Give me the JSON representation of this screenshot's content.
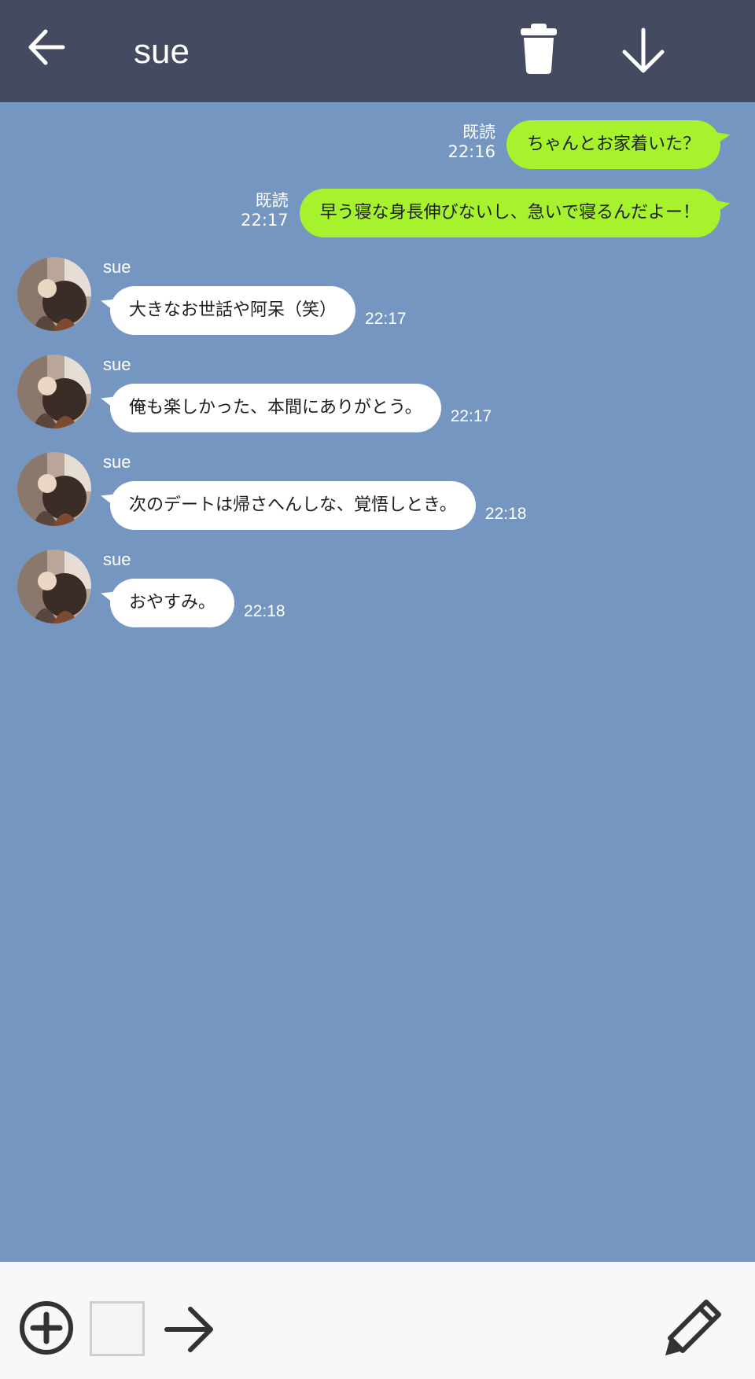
{
  "header": {
    "title": "sue",
    "back_icon": "arrow-left-icon",
    "trash_icon": "trash-icon",
    "download_icon": "arrow-down-icon"
  },
  "messages": [
    {
      "direction": "sent",
      "read": "既読",
      "time": "22:16",
      "text": "ちゃんとお家着いた？"
    },
    {
      "direction": "sent",
      "read": "既読",
      "time": "22:17",
      "text": "早う寝な身長伸びないし、急いで寝るんだよー！"
    },
    {
      "direction": "received",
      "sender": "sue",
      "time": "22:17",
      "text": "大きなお世話や阿呆（笑）"
    },
    {
      "direction": "received",
      "sender": "sue",
      "time": "22:17",
      "text": "俺も楽しかった、本間にありがとう。"
    },
    {
      "direction": "received",
      "sender": "sue",
      "time": "22:18",
      "text": "次のデートは帰さへんしな、覚悟しとき。"
    },
    {
      "direction": "received",
      "sender": "sue",
      "time": "22:18",
      "text": "おやすみ。"
    }
  ],
  "input_bar": {
    "plus_icon": "plus-circle-icon",
    "image_icon": "image-box",
    "send_icon": "arrow-right-icon",
    "edit_icon": "pencil-icon"
  },
  "colors": {
    "header_bg": "#444b61",
    "chat_bg": "#7596c1",
    "sent_bubble": "#a6f22c",
    "received_bubble": "#ffffff",
    "input_bar_bg": "#f8f8fb"
  }
}
